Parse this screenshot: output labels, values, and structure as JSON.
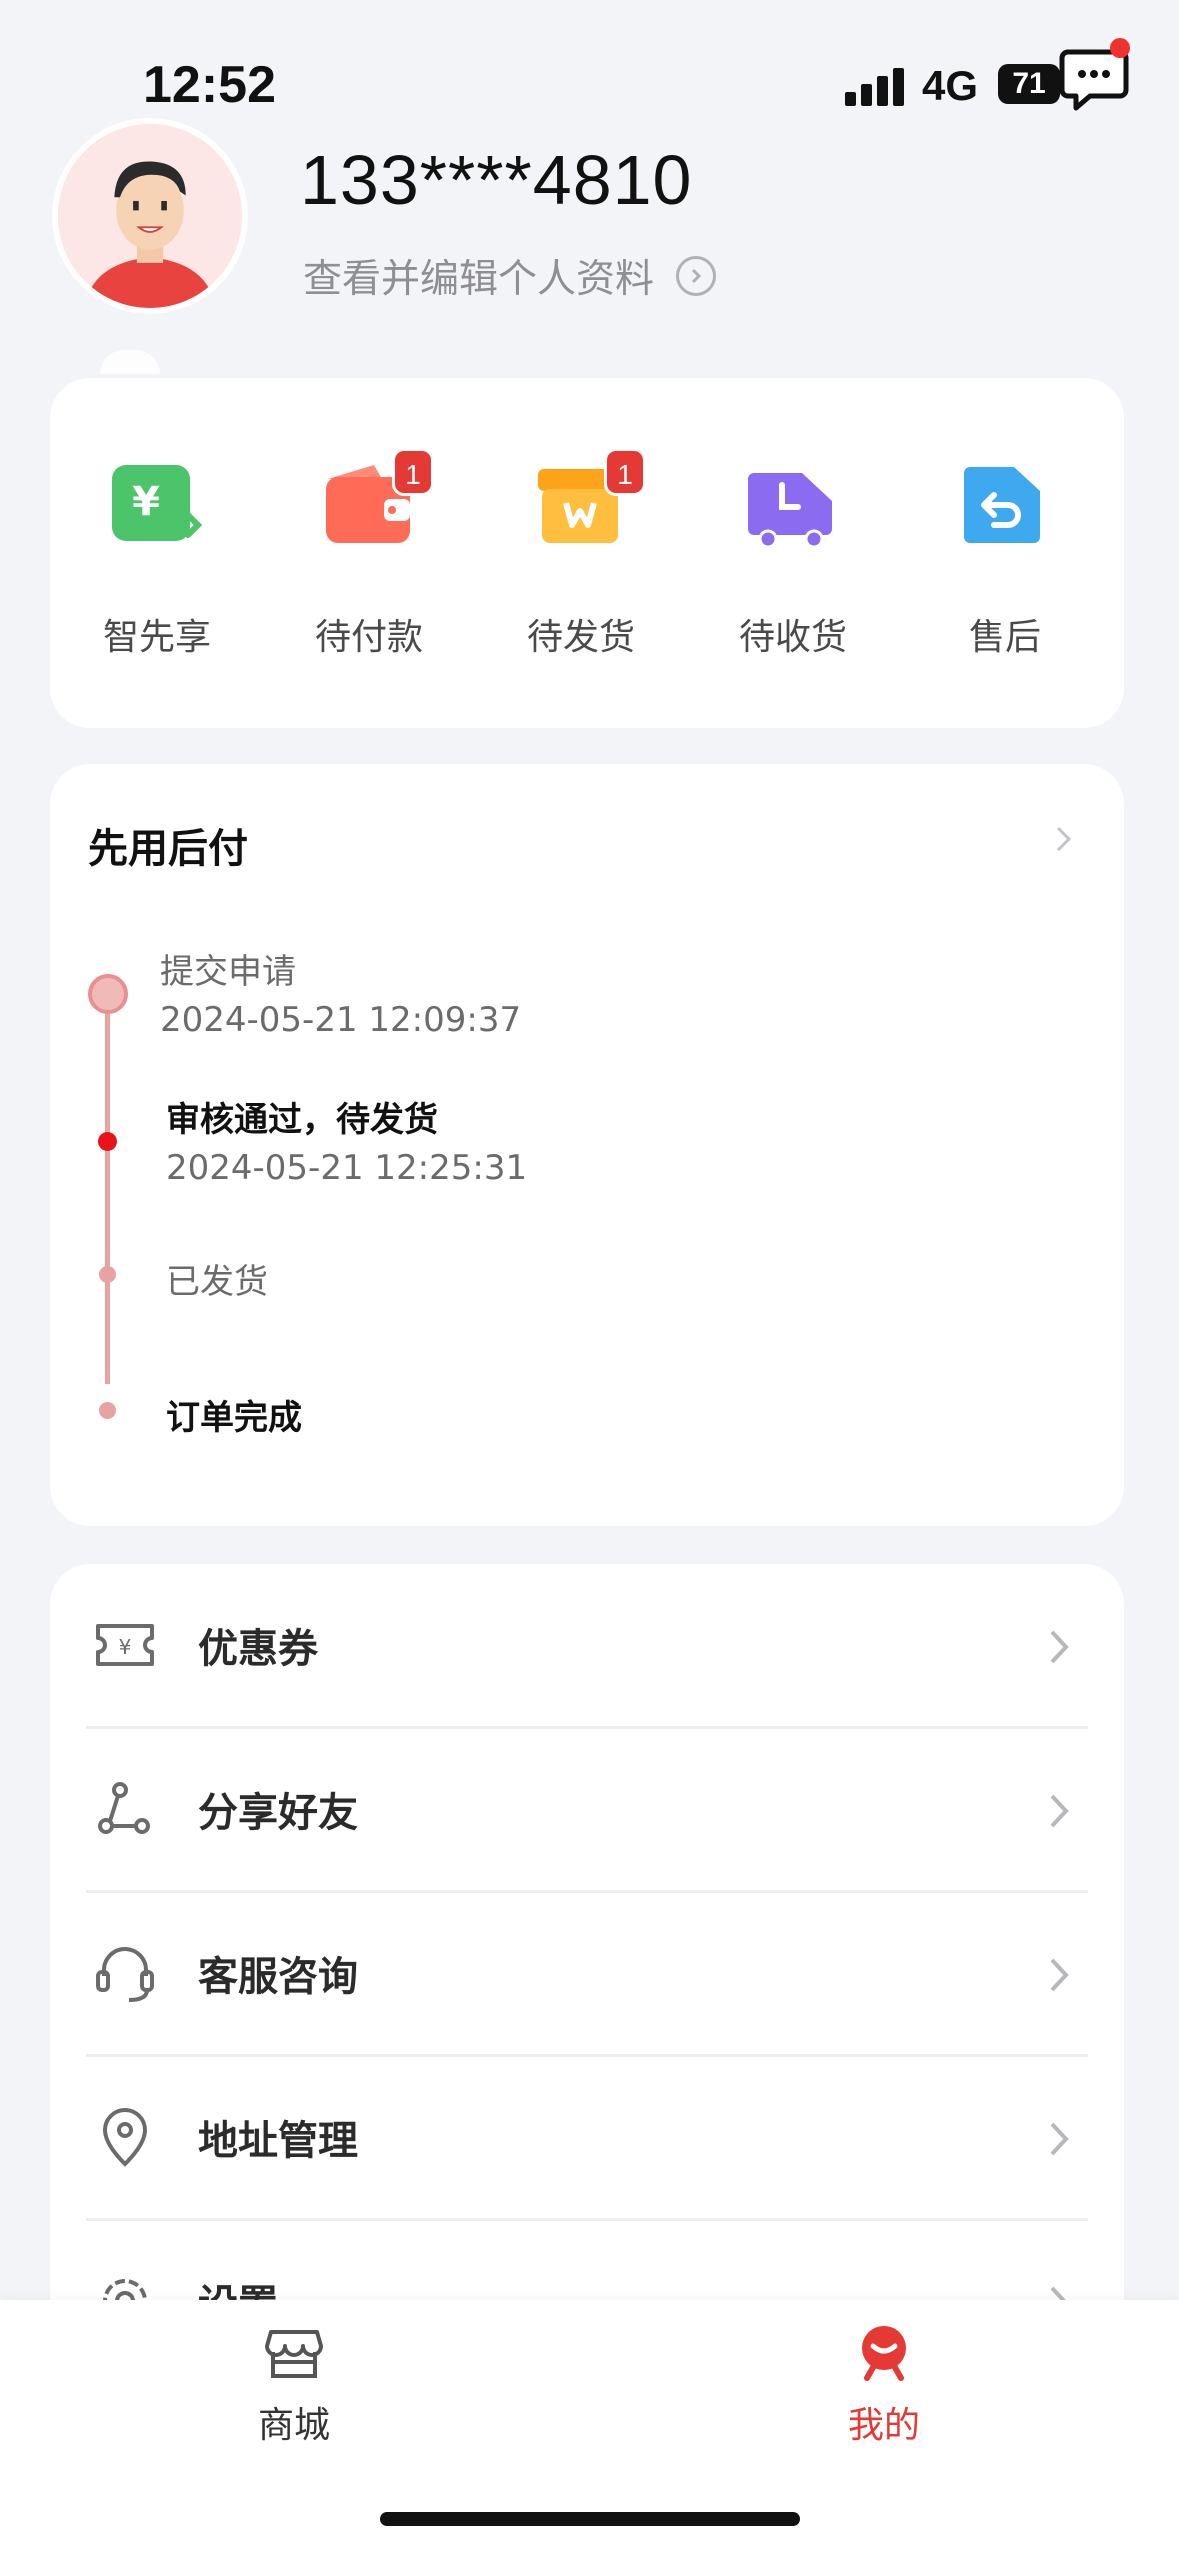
{
  "status_bar": {
    "time": "12:52",
    "network": "4G",
    "battery": "71"
  },
  "profile": {
    "phone": "133****4810",
    "edit_text": "查看并编辑个人资料"
  },
  "orders": [
    {
      "label": "智先享",
      "icon": "yen-transfer-icon",
      "badge": ""
    },
    {
      "label": "待付款",
      "icon": "wallet-icon",
      "badge": "1"
    },
    {
      "label": "待发货",
      "icon": "package-icon",
      "badge": "1"
    },
    {
      "label": "待收货",
      "icon": "truck-icon",
      "badge": ""
    },
    {
      "label": "售后",
      "icon": "return-icon",
      "badge": ""
    }
  ],
  "timeline": {
    "title": "先用后付",
    "steps": [
      {
        "label": "提交申请",
        "date": "2024-05-21 12:09:37"
      },
      {
        "label": "审核通过，待发货",
        "date": "2024-05-21 12:25:31"
      },
      {
        "label": "已发货",
        "date": ""
      },
      {
        "label": "订单完成",
        "date": ""
      }
    ]
  },
  "menu": [
    {
      "label": "优惠券",
      "icon": "coupon-icon"
    },
    {
      "label": "分享好友",
      "icon": "share-icon"
    },
    {
      "label": "客服咨询",
      "icon": "headset-icon"
    },
    {
      "label": "地址管理",
      "icon": "location-icon"
    },
    {
      "label": "设置",
      "icon": "settings-icon"
    }
  ],
  "tabbar": [
    {
      "label": "商城",
      "icon": "store-icon"
    },
    {
      "label": "我的",
      "icon": "profile-icon"
    }
  ],
  "colors": {
    "accent": "#e53935",
    "timeline": "#e9a2a2"
  }
}
